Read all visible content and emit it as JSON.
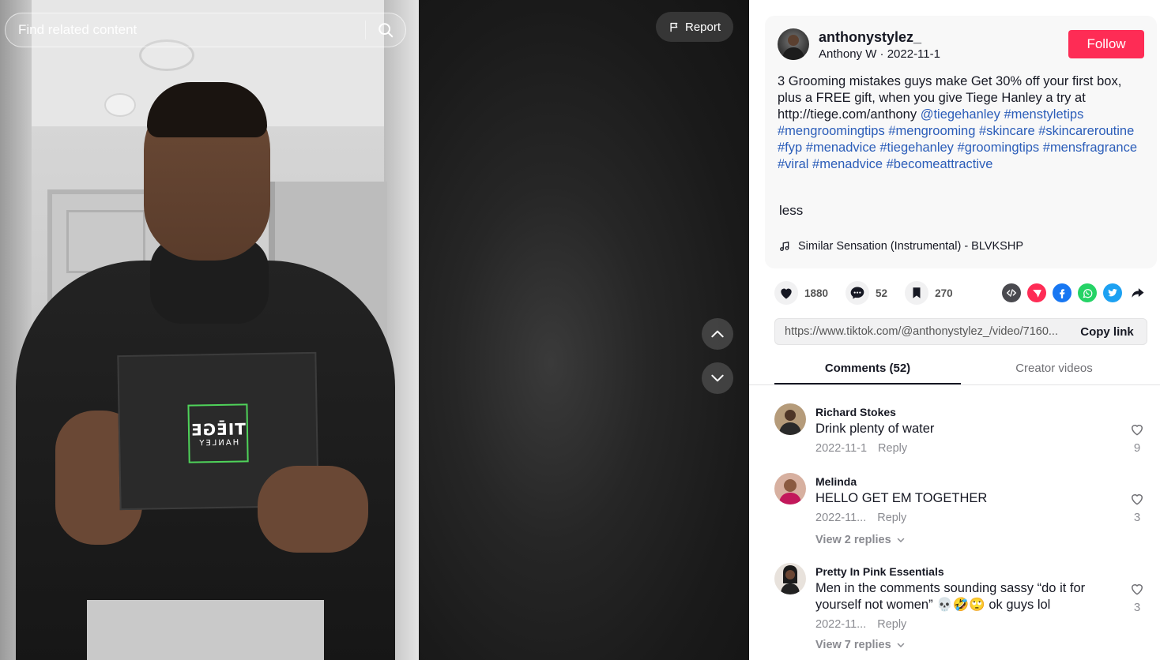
{
  "search": {
    "placeholder": "Find related content"
  },
  "video": {
    "report_label": "Report",
    "box_logo_line1": "TIĒGE",
    "box_logo_line2": "HANLEY"
  },
  "author": {
    "username": "anthonystylez_",
    "subtitle": "Anthony W · 2022-11-1",
    "follow_label": "Follow"
  },
  "description": {
    "text": "3 Grooming mistakes guys make Get 30% off your first box, plus a FREE gift, when you give Tiege Hanley a try at http://tiege.com/anthony ",
    "tags": [
      "@tiegehanley",
      "#menstyletips",
      "#mengroomingtips",
      "#mengrooming",
      "#skincare",
      "#skincareroutine",
      "#fyp",
      "#menadvice",
      "#tiegehanley",
      "#groomingtips",
      "#mensfragrance",
      "#viral",
      "#menadvice",
      "#becomeattractive"
    ],
    "less_label": "less",
    "music": "Similar Sensation (Instrumental) - BLVKSHP"
  },
  "actions": {
    "likes": "1880",
    "comments": "52",
    "saves": "270"
  },
  "share": {
    "icons": [
      "embed-icon",
      "send-icon",
      "facebook-icon",
      "whatsapp-icon",
      "twitter-icon",
      "share-arrow-icon"
    ],
    "colors": {
      "embed": "#4a4a4f",
      "send": "#fe2c55",
      "facebook": "#1877f2",
      "whatsapp": "#25d366",
      "twitter": "#1da1f2"
    }
  },
  "link": {
    "url": "https://www.tiktok.com/@anthonystylez_/video/7160...",
    "copy_label": "Copy link"
  },
  "tabs": {
    "comments": "Comments (52)",
    "creator_videos": "Creator videos"
  },
  "comments": [
    {
      "user": "Richard Stokes",
      "text": "Drink plenty of water",
      "date": "2022-11-1",
      "reply": "Reply",
      "likes": "9"
    },
    {
      "user": "Melinda",
      "text": "HELLO GET EM TOGETHER",
      "date": "2022-11...",
      "reply": "Reply",
      "likes": "3",
      "view_replies": "View 2 replies"
    },
    {
      "user": "Pretty In Pink Essentials",
      "text": "Men in the comments sounding sassy “do it for yourself not women” 💀🤣🙄 ok guys lol",
      "date": "2022-11...",
      "reply": "Reply",
      "likes": "3",
      "view_replies": "View 7 replies"
    }
  ],
  "colors": {
    "accent": "#fe2c55",
    "hashtag": "#2b5db9",
    "muted": "#8a8b91"
  }
}
